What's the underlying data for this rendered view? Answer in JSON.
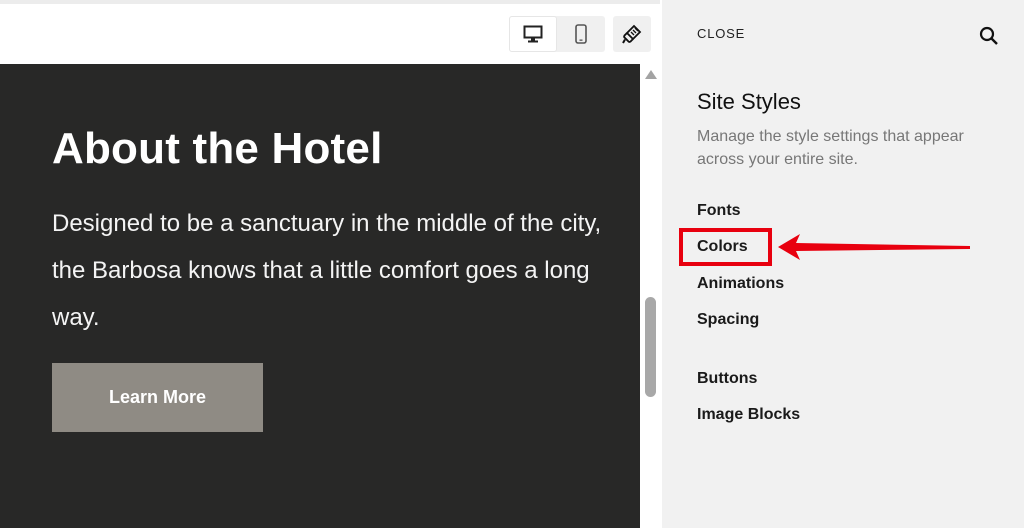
{
  "toolbar": {
    "desktop_icon": "desktop-icon",
    "mobile_icon": "mobile-icon",
    "style_icon": "paintbrush-icon"
  },
  "preview": {
    "title": "About the Hotel",
    "body": "Designed to be a sanctuary in the middle of the city, the Barbosa knows that a little comfort goes a long way.",
    "button_label": "Learn More",
    "background_color": "#282827",
    "button_color": "#8f8b84"
  },
  "panel": {
    "close_label": "CLOSE",
    "search_icon": "search-icon",
    "title": "Site Styles",
    "description": "Manage the style settings that appear across your entire site.",
    "items": [
      {
        "label": "Fonts"
      },
      {
        "label": "Colors",
        "highlighted": true
      },
      {
        "label": "Animations"
      },
      {
        "label": "Spacing"
      },
      {
        "label": "Buttons"
      },
      {
        "label": "Image Blocks"
      }
    ],
    "highlight_color": "#e8000f"
  }
}
